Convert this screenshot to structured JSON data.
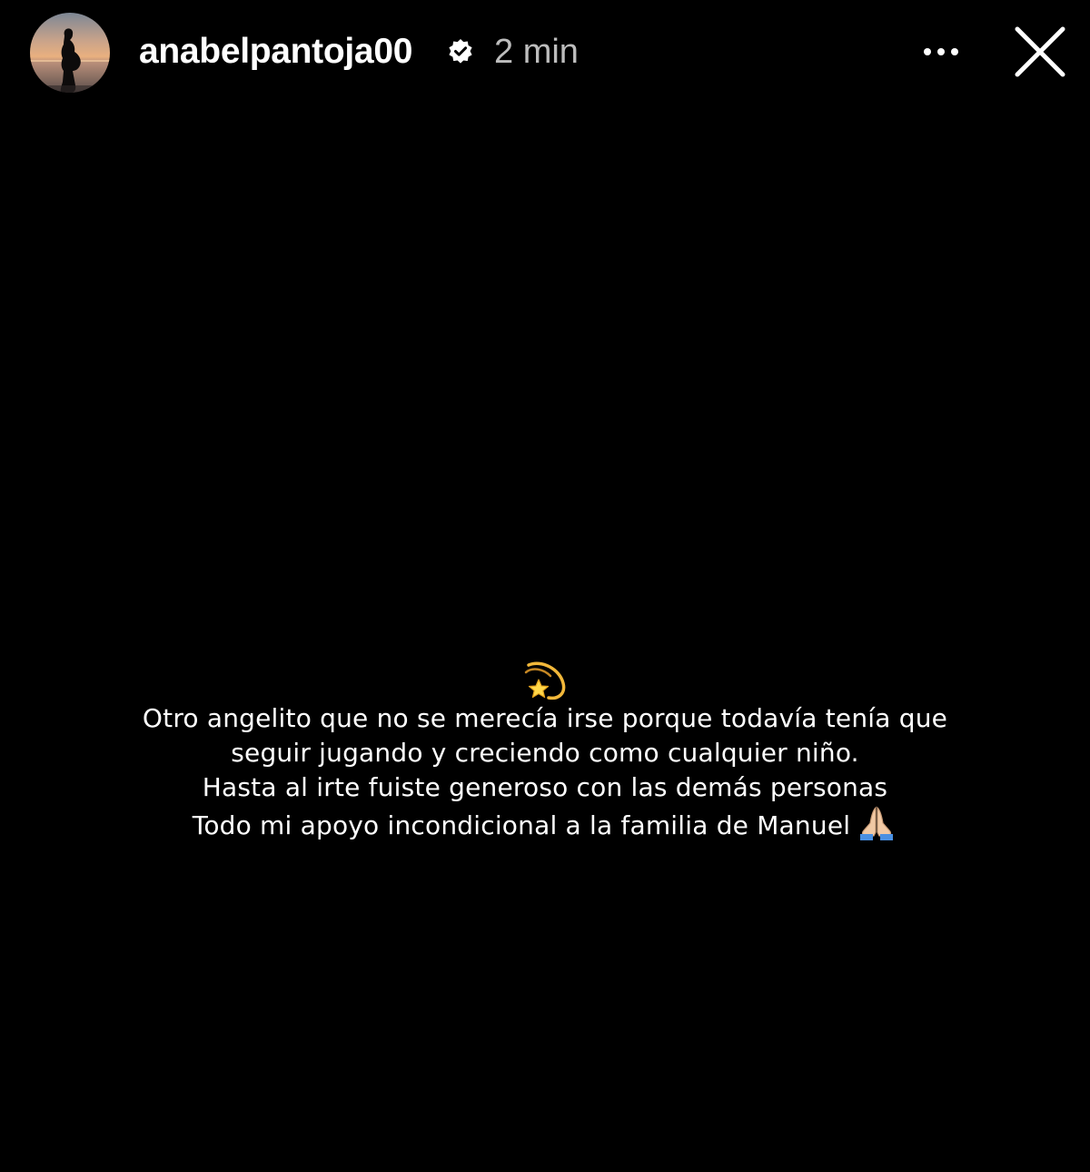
{
  "header": {
    "avatar_alt": "profile picture",
    "username": "anabelpantoja00",
    "verified_icon": "verified-badge-icon",
    "timestamp": "2 min",
    "more_icon": "more-options-icon",
    "close_icon": "close-icon"
  },
  "story": {
    "background_color": "#000000",
    "top_emoji": "💫",
    "caption_lines": [
      "Otro angelito que no se merecía irse porque todavía tenía que",
      "seguir jugando y creciendo como cualquier niño.",
      "Hasta al irte fuiste generoso con las demás personas",
      "Todo mi apoyo incondicional a la familia de Manuel"
    ],
    "end_emoji": "🙏🏼"
  }
}
